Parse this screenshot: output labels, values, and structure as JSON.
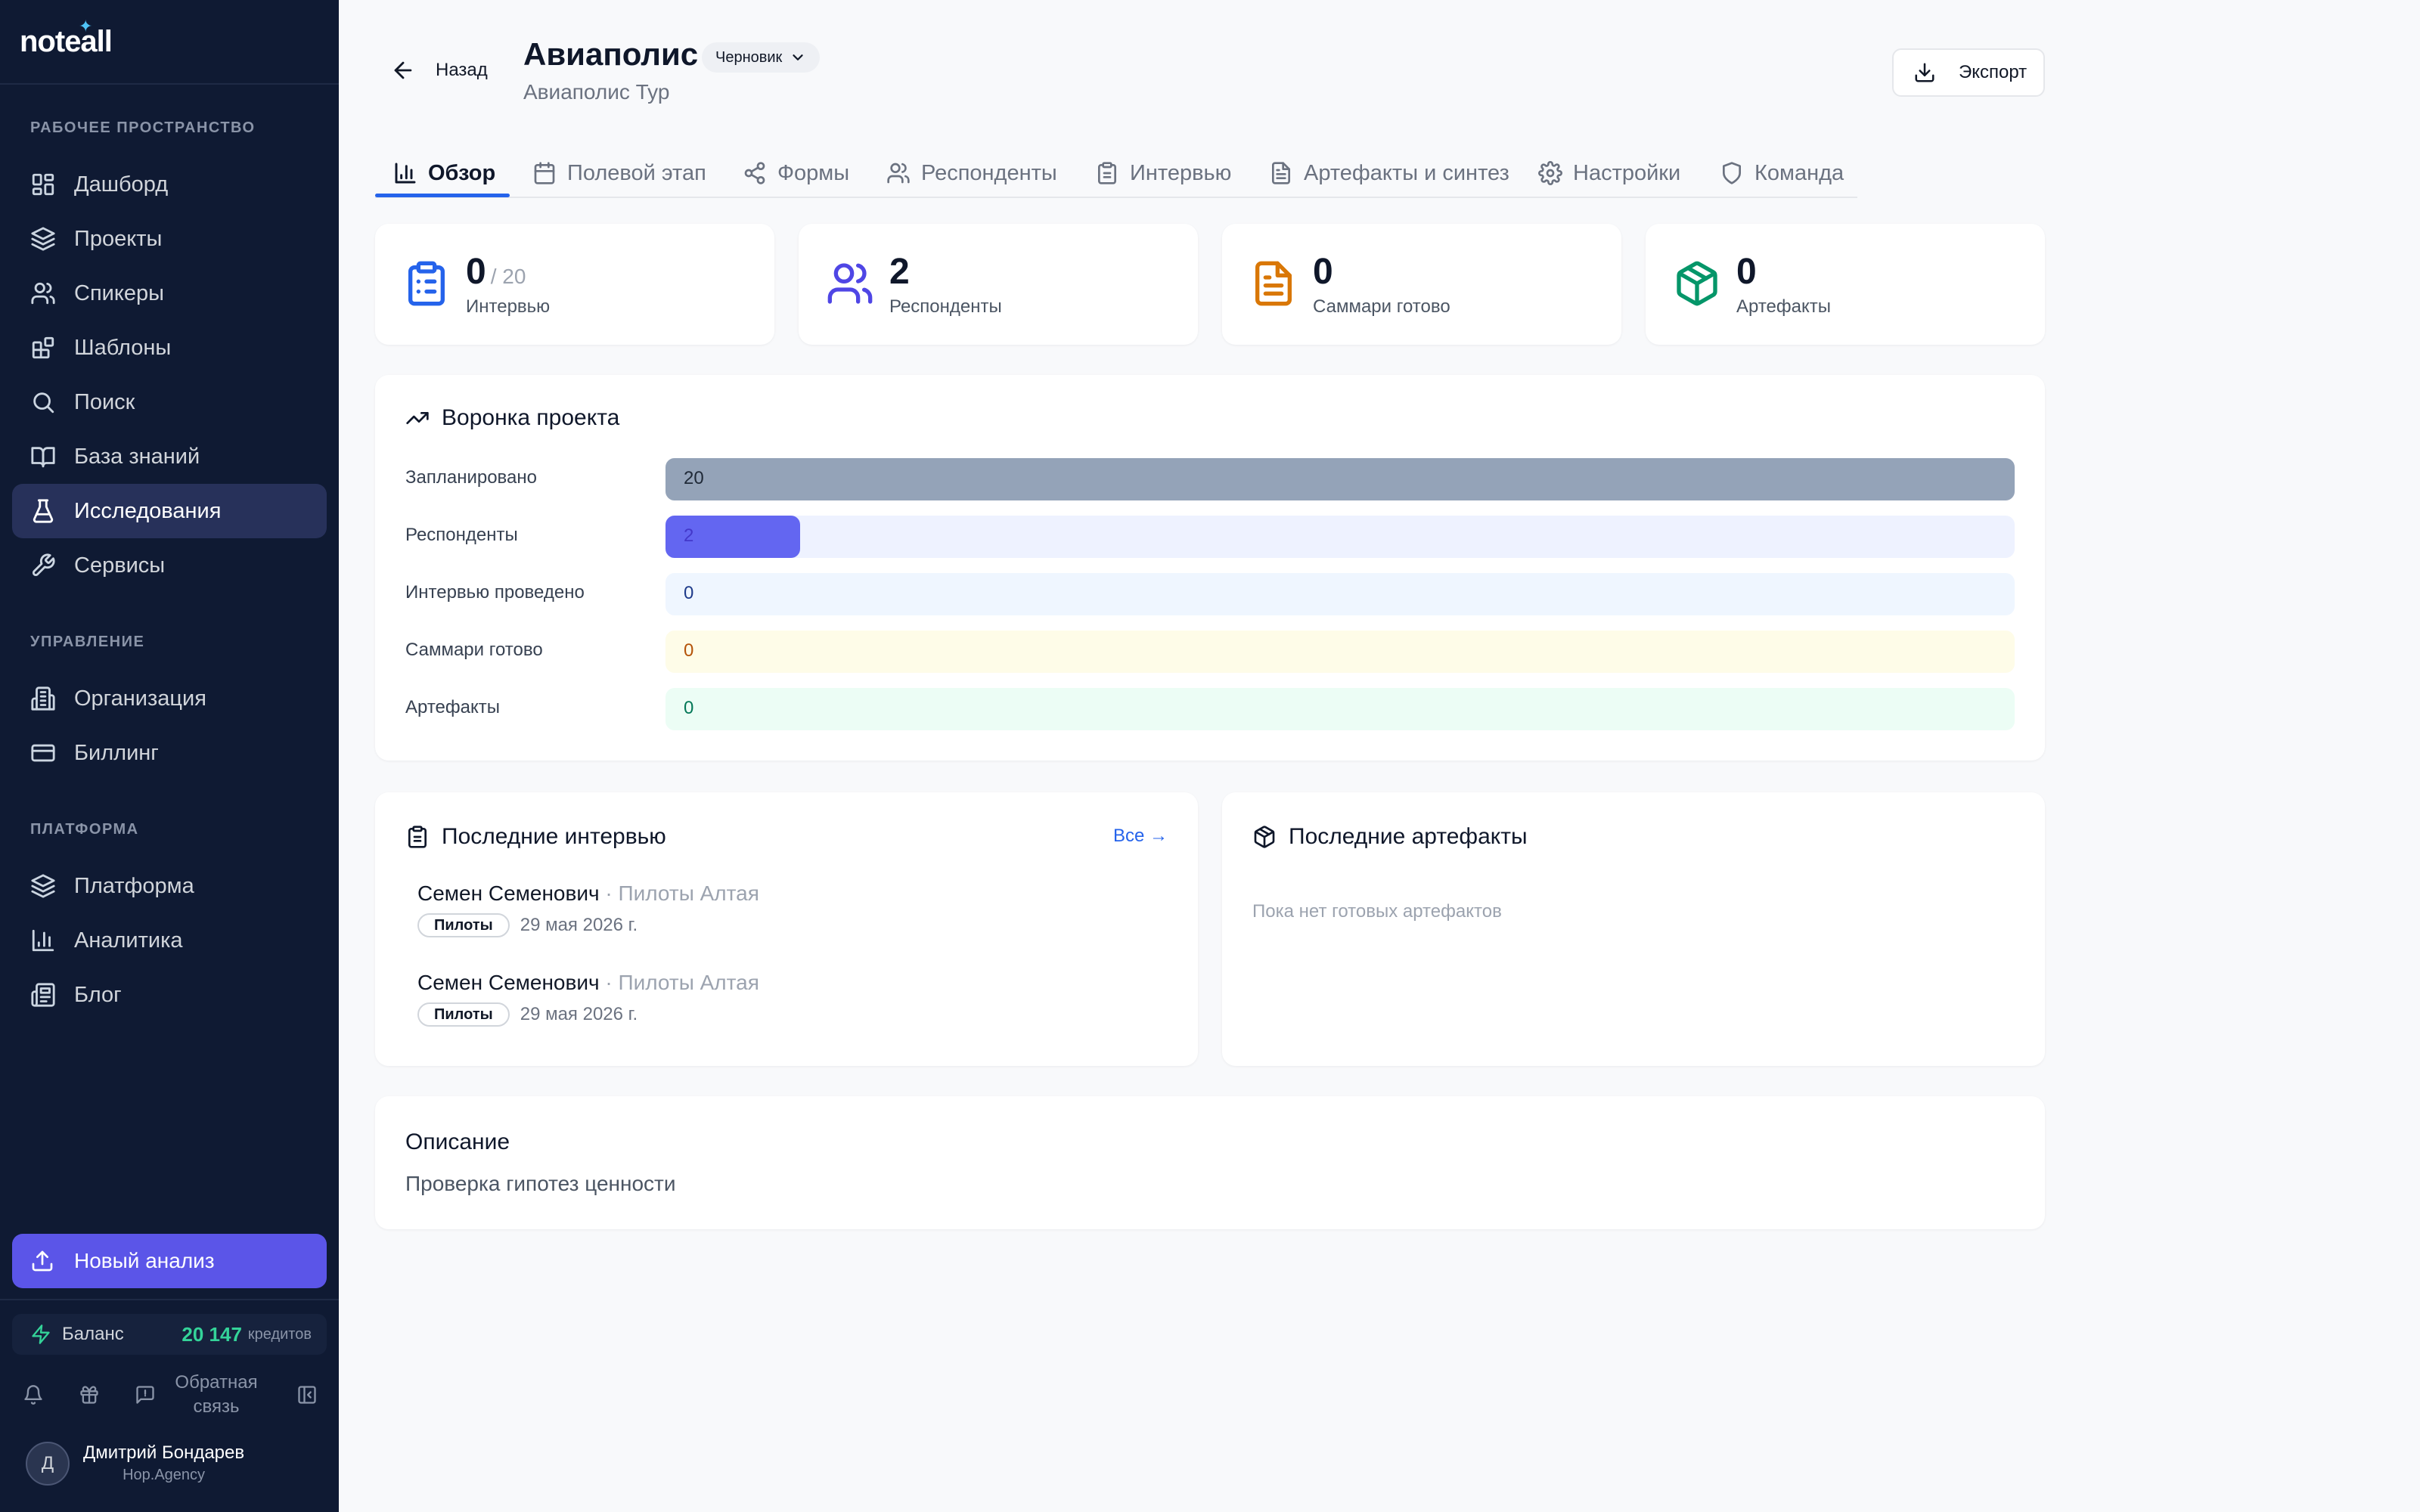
{
  "app": {
    "logo": "noteall"
  },
  "sidebar": {
    "sections": [
      {
        "label": "РАБОЧЕЕ ПРОСТРАНСТВО"
      },
      {
        "label": "УПРАВЛЕНИЕ"
      },
      {
        "label": "ПЛАТФОРМА"
      }
    ],
    "items": [
      {
        "label": "Дашборд",
        "icon": "layout-dashboard-icon"
      },
      {
        "label": "Проекты",
        "icon": "layers-icon"
      },
      {
        "label": "Спикеры",
        "icon": "users-icon"
      },
      {
        "label": "Шаблоны",
        "icon": "blocks-icon"
      },
      {
        "label": "Поиск",
        "icon": "search-icon"
      },
      {
        "label": "База знаний",
        "icon": "book-open-icon"
      },
      {
        "label": "Исследования",
        "icon": "flask-icon",
        "active": true
      },
      {
        "label": "Сервисы",
        "icon": "wrench-icon"
      },
      {
        "label": "Организация",
        "icon": "building-icon"
      },
      {
        "label": "Биллинг",
        "icon": "credit-card-icon"
      },
      {
        "label": "Платформа",
        "icon": "layers-icon"
      },
      {
        "label": "Аналитика",
        "icon": "bar-chart-icon"
      },
      {
        "label": "Блог",
        "icon": "newspaper-icon"
      }
    ],
    "new_analysis": "Новый анализ",
    "balance": {
      "label": "Баланс",
      "amount": "20 147",
      "unit": "кредитов"
    },
    "feedback": "Обратная связь",
    "user": {
      "initial": "Д",
      "name": "Дмитрий Бондарев",
      "org": "Hop.Agency"
    }
  },
  "header": {
    "back": "Назад",
    "title": "Авиаполис",
    "status": "Черновик",
    "subtitle": "Авиаполис Тур",
    "export": "Экспорт"
  },
  "tabs": [
    {
      "label": "Обзор",
      "icon": "bar-chart-icon",
      "active": true
    },
    {
      "label": "Полевой этап",
      "icon": "calendar-icon"
    },
    {
      "label": "Формы",
      "icon": "share-icon"
    },
    {
      "label": "Респонденты",
      "icon": "users-icon"
    },
    {
      "label": "Интервью",
      "icon": "clipboard-icon"
    },
    {
      "label": "Артефакты и синтез",
      "icon": "file-text-icon"
    },
    {
      "label": "Настройки",
      "icon": "gear-icon"
    },
    {
      "label": "Команда",
      "icon": "shield-icon"
    }
  ],
  "stats": [
    {
      "value": "0",
      "of": "/ 20",
      "label": "Интервью",
      "color": "#2563eb",
      "icon": "clipboard-list-icon"
    },
    {
      "value": "2",
      "of": "",
      "label": "Респонденты",
      "color": "#4f46e5",
      "icon": "users-icon"
    },
    {
      "value": "0",
      "of": "",
      "label": "Саммари готово",
      "color": "#d97706",
      "icon": "file-text-icon"
    },
    {
      "value": "0",
      "of": "",
      "label": "Артефакты",
      "color": "#059669",
      "icon": "package-icon"
    }
  ],
  "funnel": {
    "title": "Воронка проекта",
    "max": 20,
    "rows": [
      {
        "label": "Запланировано",
        "value": 20,
        "track": "#e5e7eb",
        "fill": "#94a3b8",
        "text": "#1f2937"
      },
      {
        "label": "Респонденты",
        "value": 2,
        "track": "#eef2ff",
        "fill": "#6366f1",
        "text": "#4338ca"
      },
      {
        "label": "Интервью проведено",
        "value": 0,
        "track": "#eff6ff",
        "fill": "#3b82f6",
        "text": "#1e3a8a"
      },
      {
        "label": "Саммари готово",
        "value": 0,
        "track": "#fefce8",
        "fill": "#f59e0b",
        "text": "#b45309"
      },
      {
        "label": "Артефакты",
        "value": 0,
        "track": "#ecfdf5",
        "fill": "#10b981",
        "text": "#047857"
      }
    ]
  },
  "recent_interviews": {
    "title": "Последние интервью",
    "all_link": "Все →",
    "items": [
      {
        "name": "Семен Семенович",
        "group": "· Пилоты Алтая",
        "tag": "Пилоты",
        "date": "29 мая 2026 г."
      },
      {
        "name": "Семен Семенович",
        "group": "· Пилоты Алтая",
        "tag": "Пилоты",
        "date": "29 мая 2026 г."
      }
    ]
  },
  "recent_artifacts": {
    "title": "Последние артефакты",
    "empty": "Пока нет готовых артефактов"
  },
  "description": {
    "title": "Описание",
    "text": "Проверка гипотез ценности"
  }
}
